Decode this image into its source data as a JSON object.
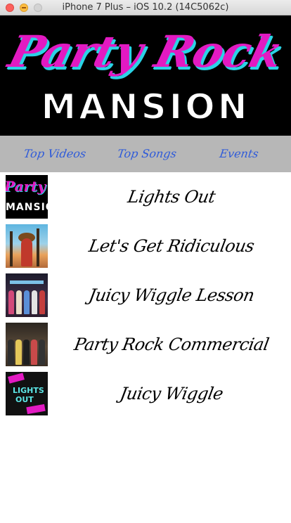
{
  "window": {
    "title": "iPhone 7 Plus – iOS 10.2 (14C5062c)"
  },
  "banner": {
    "logo_top": "Party Rock",
    "logo_bottom": "MANSION"
  },
  "nav": {
    "tabs": [
      {
        "label": "Top Videos"
      },
      {
        "label": "Top Songs"
      },
      {
        "label": "Events"
      }
    ]
  },
  "videos": [
    {
      "title": "Lights Out",
      "thumb_icon": "party-rock-mansion-thumbnail",
      "thumb_text_top": "Party Rock",
      "thumb_text_bottom": "MANSION"
    },
    {
      "title": "Let's Get Ridiculous",
      "thumb_icon": "beach-palm-thumbnail"
    },
    {
      "title": "Juicy Wiggle Lesson",
      "thumb_icon": "dancers-thumbnail"
    },
    {
      "title": "Party Rock Commercial",
      "thumb_icon": "crowd-dancing-thumbnail"
    },
    {
      "title": "Juicy Wiggle",
      "thumb_icon": "lights-out-poster-thumbnail",
      "thumb_text_top": "LIGHTS",
      "thumb_text_bottom": "OUT"
    }
  ],
  "colors": {
    "logo_pink": "#e21ac2",
    "logo_cyan": "#2ad3e6",
    "nav_bg": "#b7b7b7",
    "nav_text": "#2f5bd9"
  }
}
